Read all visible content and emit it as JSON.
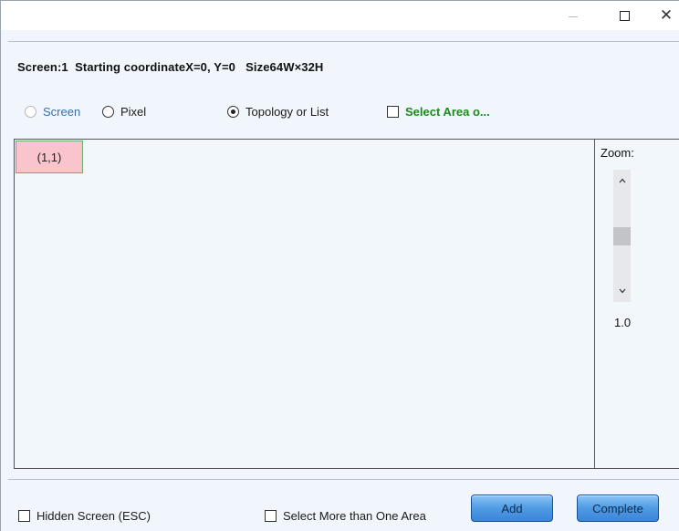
{
  "window": {
    "title_buttons": {
      "minimize_icon": "minimize-icon",
      "maximize_icon": "maximize-icon",
      "close_glyph": "✕"
    }
  },
  "info": {
    "text": "Screen:1  Starting coordinateX=0, Y=0   Size64W×32H"
  },
  "modes": {
    "screen": {
      "label": "Screen",
      "selected": false,
      "enabled": false
    },
    "pixel": {
      "label": "Pixel",
      "selected": false,
      "enabled": true
    },
    "topology": {
      "label": "Topology or List",
      "selected": true,
      "enabled": true
    }
  },
  "select_area": {
    "label": "Select Area o...",
    "checked": false,
    "color": "#1c8a1c"
  },
  "canvas": {
    "cells": [
      {
        "label": "(1,1)",
        "color": "#f9c4cc"
      }
    ]
  },
  "zoom": {
    "label": "Zoom:",
    "value": "1.0",
    "up_glyph": "⌃",
    "down_glyph": "⌄"
  },
  "footer": {
    "hidden_screen_label": "Hidden Screen (ESC)",
    "select_more_label": "Select More than One Area",
    "add_label": "Add",
    "complete_label": "Complete",
    "button_color": "#4f9be4"
  }
}
